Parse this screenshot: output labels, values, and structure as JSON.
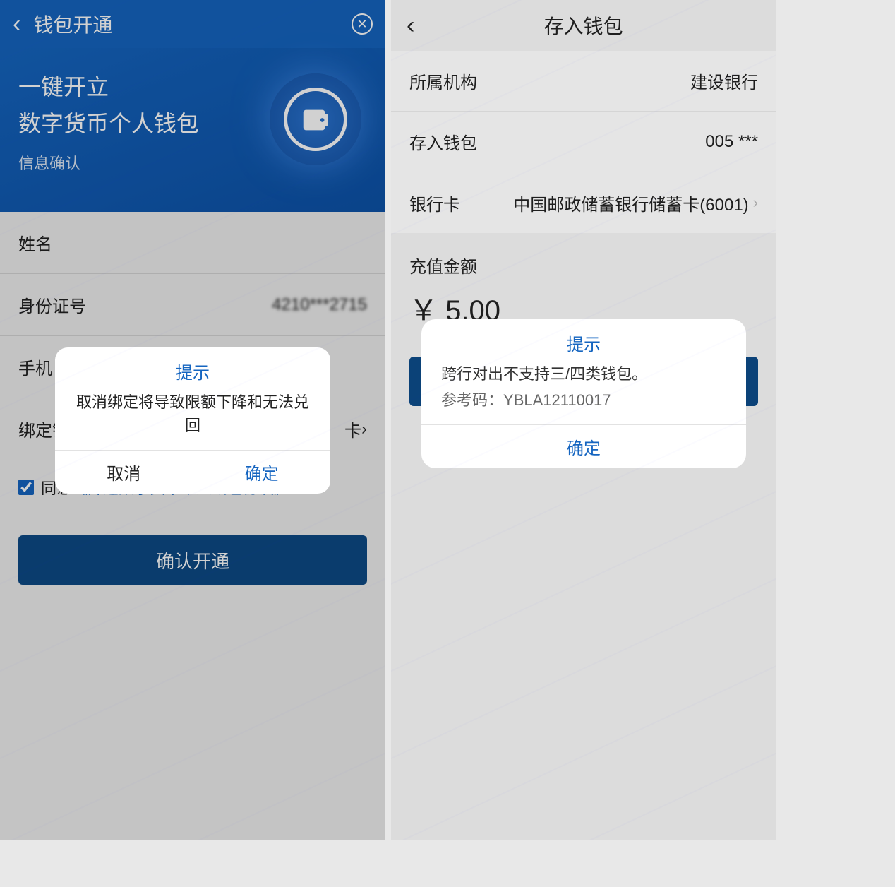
{
  "left": {
    "header": {
      "title": "钱包开通"
    },
    "hero": {
      "line1": "一键开立",
      "line2": "数字货币个人钱包",
      "sub": "信息确认"
    },
    "rows": {
      "name": {
        "label": "姓名",
        "value": ""
      },
      "idnum": {
        "label": "身份证号",
        "value": "4210***2715"
      },
      "phone": {
        "label": "手机",
        "value": ""
      },
      "bindCard": {
        "label": "绑定银行卡",
        "chev": "›",
        "suffix": "卡"
      }
    },
    "agree": {
      "text": "同意",
      "link": "《开通数字货币个人钱包协议》"
    },
    "submit": "确认开通",
    "dialog": {
      "title": "提示",
      "msg": "取消绑定将导致限额下降和无法兑回",
      "cancel": "取消",
      "ok": "确定"
    }
  },
  "right": {
    "header": {
      "title": "存入钱包"
    },
    "rows": {
      "org": {
        "label": "所属机构",
        "value": "建设银行"
      },
      "wallet": {
        "label": "存入钱包",
        "value": "005 ***  "
      },
      "card": {
        "label": "银行卡",
        "value": "中国邮政储蓄银行储蓄卡(6001)"
      }
    },
    "amountLabel": "充值金额",
    "amountValue": "￥ 5.00",
    "dialog": {
      "title": "提示",
      "msg": "跨行对出不支持三/四类钱包。",
      "refLabel": "参考码：",
      "ref": "YBLA12110017",
      "ok": "确定"
    }
  }
}
